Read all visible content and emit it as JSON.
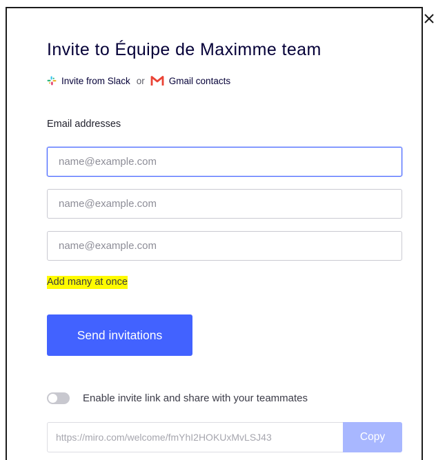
{
  "dialog": {
    "title": "Invite to Équipe de Maximme team",
    "close_icon": "close-icon"
  },
  "import": {
    "slack_icon": "slack-icon",
    "slack_label": "Invite from Slack",
    "or_label": "or",
    "gmail_icon": "gmail-icon",
    "gmail_label": "Gmail contacts"
  },
  "emails": {
    "label": "Email addresses",
    "fields": [
      {
        "value": "",
        "placeholder": "name@example.com",
        "focused": true
      },
      {
        "value": "",
        "placeholder": "name@example.com",
        "focused": false
      },
      {
        "value": "",
        "placeholder": "name@example.com",
        "focused": false
      }
    ],
    "add_many_label": "Add many at once",
    "highlight_color": "#fffb00"
  },
  "send": {
    "label": "Send invitations",
    "color": "#4262ff"
  },
  "invite_link": {
    "enabled": false,
    "toggle_label": "Enable invite link and share with your teammates",
    "url": "https://miro.com/welcome/fmYhI2HOKUxMvLSJ43",
    "copy_label": "Copy",
    "copy_color": "#a8b7ff"
  }
}
